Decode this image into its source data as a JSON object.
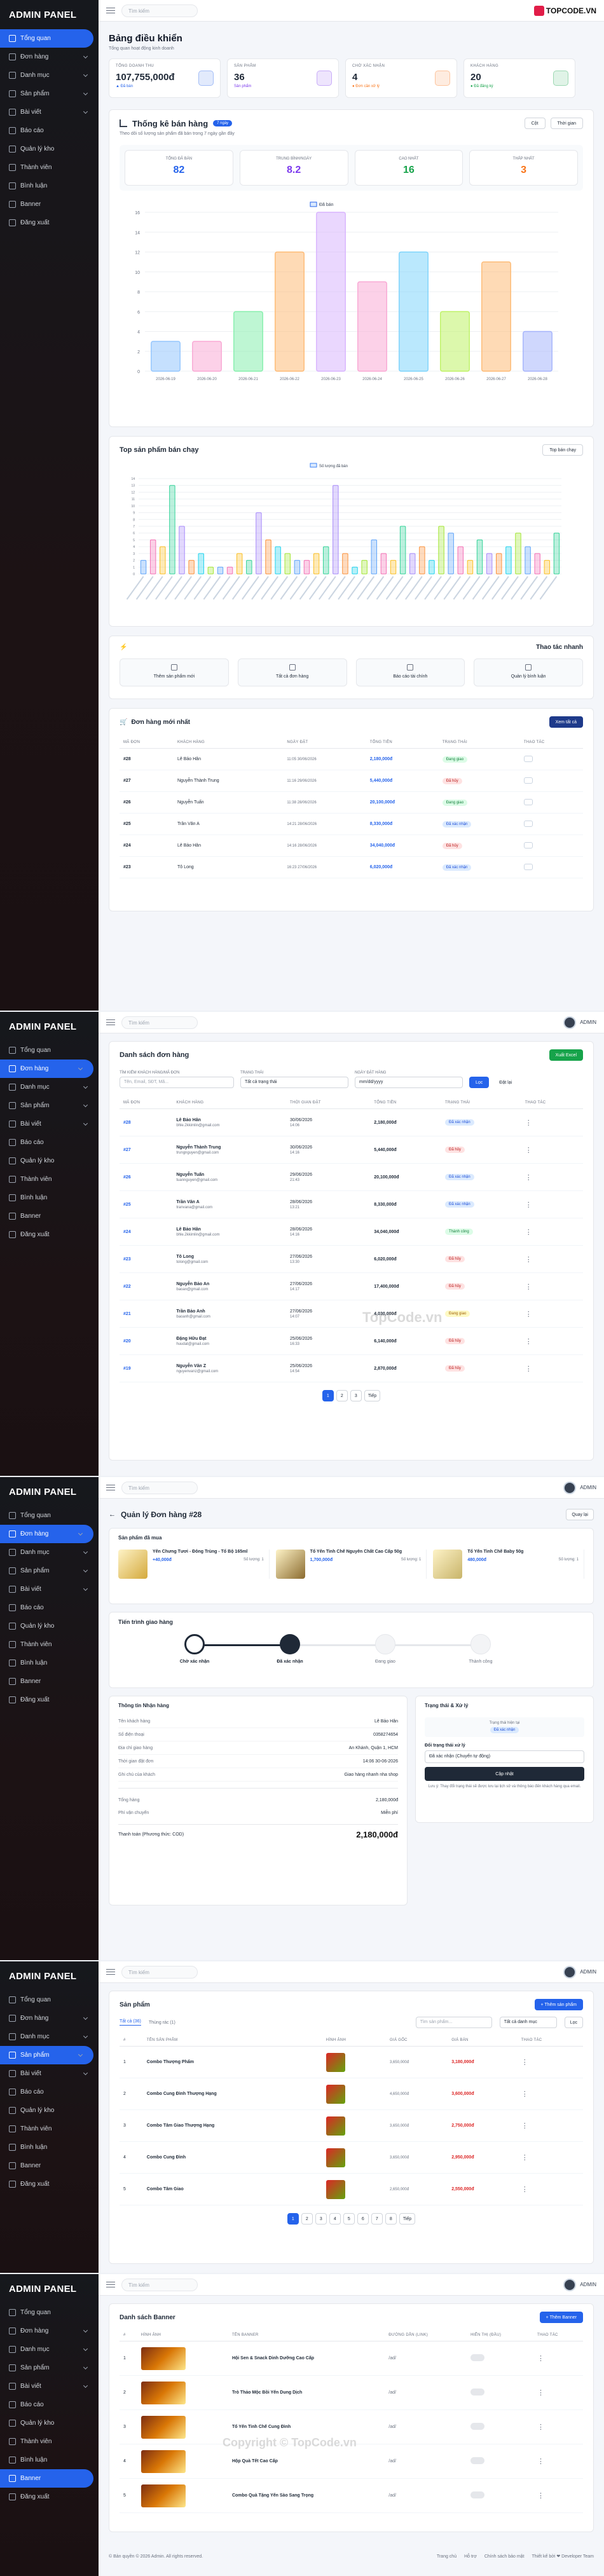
{
  "logo": {
    "brand": "TOPCODE.VN"
  },
  "watermarks": [
    "TopCode.vn",
    "Copyright © TopCode.vn"
  ],
  "sidebar": {
    "brand": "ADMIN PANEL",
    "items": [
      {
        "label": "Tổng quan",
        "icon": "grid-icon"
      },
      {
        "label": "Đơn hàng",
        "icon": "cart-icon"
      },
      {
        "label": "Danh mục",
        "icon": "folder-icon"
      },
      {
        "label": "Sản phẩm",
        "icon": "box-icon"
      },
      {
        "label": "Bài viết",
        "icon": "doc-icon"
      },
      {
        "label": "Báo cáo",
        "icon": "chart-icon"
      },
      {
        "label": "Quản lý kho",
        "icon": "warehouse-icon"
      },
      {
        "label": "Thành viên",
        "icon": "users-icon"
      },
      {
        "label": "Bình luận",
        "icon": "comment-icon"
      },
      {
        "label": "Banner",
        "icon": "image-icon"
      },
      {
        "label": "Đăng xuất",
        "icon": "logout-icon"
      }
    ]
  },
  "topbar": {
    "search_placeholder": "Tìm kiếm",
    "user": "ADMIN"
  },
  "dashboard": {
    "title": "Bảng điều khiển",
    "subtitle": "Tổng quan hoạt động kinh doanh",
    "stats": [
      {
        "label": "TỔNG DOANH THU",
        "value": "107,755,000đ",
        "sub": "▲ Đã bán",
        "color": "#2563eb"
      },
      {
        "label": "SẢN PHẨM",
        "value": "36",
        "sub": "Sản phẩm",
        "color": "#7c3aed"
      },
      {
        "label": "CHỜ XÁC NHẬN",
        "value": "4",
        "sub": "● Đơn cần xử lý",
        "color": "#f97316"
      },
      {
        "label": "KHÁCH HÀNG",
        "value": "20",
        "sub": "● Đã đăng ký",
        "color": "#16a34a"
      }
    ],
    "sales": {
      "title": "Thống kê bán hàng",
      "tag": "7 ngày",
      "desc": "Theo dõi số lượng sản phẩm đã bán trong 7 ngày gần đây",
      "btn_type": "Cột",
      "btn_time": "Thời gian",
      "kpis": [
        {
          "label": "TỔNG ĐÃ BÁN",
          "value": "82",
          "color": "#2563eb"
        },
        {
          "label": "TRUNG BÌNH/NGÀY",
          "value": "8.2",
          "color": "#7c3aed"
        },
        {
          "label": "CAO NHẤT",
          "value": "16",
          "color": "#16a34a"
        },
        {
          "label": "THẤP NHẤT",
          "value": "3",
          "color": "#f97316"
        }
      ]
    },
    "top_products": {
      "title": "Top sản phẩm bán chạy",
      "select": "Top bán chạy"
    },
    "quick": {
      "title": "Thao tác nhanh",
      "items": [
        "Thêm sản phẩm mới",
        "Tất cả đơn hàng",
        "Báo cáo tài chính",
        "Quản lý bình luận"
      ]
    },
    "recent": {
      "title": "Đơn hàng mới nhất",
      "btn": "Xem tất cả",
      "headers": [
        "MÃ ĐƠN",
        "KHÁCH HÀNG",
        "NGÀY ĐẶT",
        "TỔNG TIỀN",
        "TRẠNG THÁI",
        "THAO TÁC"
      ],
      "rows": [
        {
          "id": "#28",
          "name": "Lê Bảo Hân",
          "date": "11:05 30/06/2026",
          "total": "2,180,000đ",
          "status": "Đang giao",
          "c": "g"
        },
        {
          "id": "#27",
          "name": "Nguyễn Thành Trung",
          "date": "11:16 29/06/2026",
          "total": "5,440,000đ",
          "status": "Đã hủy",
          "c": "r"
        },
        {
          "id": "#26",
          "name": "Nguyễn Tuấn",
          "date": "11:38 28/06/2026",
          "total": "20,100,000đ",
          "status": "Đang giao",
          "c": "g"
        },
        {
          "id": "#25",
          "name": "Trần Văn A",
          "date": "14:21 28/06/2026",
          "total": "8,330,000đ",
          "status": "Đã xác nhận",
          "c": "b"
        },
        {
          "id": "#24",
          "name": "Lê Bảo Hân",
          "date": "14:16 28/06/2026",
          "total": "34,040,000đ",
          "status": "Đã hủy",
          "c": "r"
        },
        {
          "id": "#23",
          "name": "Tô Long",
          "date": "16:23 27/06/2026",
          "total": "6,020,000đ",
          "status": "Đã xác nhận",
          "c": "b"
        }
      ]
    }
  },
  "chart_data": [
    {
      "type": "bar",
      "series": [
        {
          "name": "Đã bán",
          "values": [
            3,
            3,
            6,
            12,
            16,
            9,
            12,
            6,
            11,
            4
          ]
        }
      ],
      "categories": [
        "2026-06-19",
        "2026-06-20",
        "2026-06-21",
        "2026-06-22",
        "2026-06-23",
        "2026-06-24",
        "2026-06-25",
        "2026-06-26",
        "2026-06-27",
        "2026-06-28"
      ],
      "yticks": [
        "0",
        "2",
        "4",
        "6",
        "8",
        "10",
        "12",
        "14",
        "16"
      ],
      "ylim": [
        0,
        16
      ]
    },
    {
      "type": "bar",
      "series": [
        {
          "name": "Số lượng đã bán",
          "values": [
            2,
            5,
            4,
            13,
            7,
            2,
            3,
            1,
            1,
            1,
            3,
            2,
            9,
            5,
            4,
            3,
            2,
            2,
            3,
            4,
            13,
            3,
            1,
            2,
            5,
            3,
            2,
            7,
            3,
            4,
            2,
            7,
            6,
            4,
            2,
            5,
            3,
            3,
            4,
            6,
            4,
            3,
            2,
            6
          ]
        }
      ],
      "yticks": [
        "0",
        "1",
        "2",
        "3",
        "4",
        "5",
        "6",
        "7",
        "8",
        "9",
        "10",
        "11",
        "12",
        "13",
        "14"
      ],
      "ylim": [
        0,
        14
      ]
    }
  ],
  "orders": {
    "title": "Danh sách đơn hàng",
    "export": "Xuất Excel",
    "f_search_label": "TÌM KIẾM KHÁCH HÀNG/MÃ ĐƠN",
    "f_search_ph": "Tên, Email, SĐT, Mã...",
    "f_status_label": "TRẠNG THÁI",
    "f_status": "Tất cả trạng thái",
    "f_date_label": "NGÀY ĐẶT HÀNG",
    "f_date": "mm/dd/yyyy",
    "btn_filter": "Lọc",
    "btn_reset": "Đặt lại",
    "headers": [
      "MÃ ĐƠN",
      "KHÁCH HÀNG",
      "THỜI GIAN ĐẶT",
      "TỔNG TIỀN",
      "TRẠNG THÁI",
      "THAO TÁC"
    ],
    "rows": [
      {
        "id": "#28",
        "name": "Lê Bảo Hân",
        "email": "bhle.2kkimlin@gmail.com",
        "date": "30/06/2026",
        "time": "14:06",
        "total": "2,180,000đ",
        "status": "Đã xác nhận",
        "c": "b"
      },
      {
        "id": "#27",
        "name": "Nguyễn Thành Trung",
        "email": "trungnguyen@gmail.com",
        "date": "30/06/2026",
        "time": "14:16",
        "total": "5,440,000đ",
        "status": "Đã hủy",
        "c": "r"
      },
      {
        "id": "#26",
        "name": "Nguyễn Tuấn",
        "email": "tuannguyen@gmail.com",
        "date": "29/06/2026",
        "time": "21:43",
        "total": "20,100,000đ",
        "status": "Đã xác nhận",
        "c": "b"
      },
      {
        "id": "#25",
        "name": "Trần Văn A",
        "email": "tranvana@gmail.com",
        "date": "28/06/2026",
        "time": "13:21",
        "total": "8,330,000đ",
        "status": "Đã xác nhận",
        "c": "b"
      },
      {
        "id": "#24",
        "name": "Lê Bảo Hân",
        "email": "bhle.2kkimlin@gmail.com",
        "date": "28/06/2026",
        "time": "14:16",
        "total": "34,040,000đ",
        "status": "Thành công",
        "c": "g"
      },
      {
        "id": "#23",
        "name": "Tô Long",
        "email": "tolong@gmail.com",
        "date": "27/06/2026",
        "time": "13:30",
        "total": "6,020,000đ",
        "status": "Đã hủy",
        "c": "r"
      },
      {
        "id": "#22",
        "name": "Nguyễn Bảo An",
        "email": "baoan@gmail.com",
        "date": "27/06/2026",
        "time": "14:17",
        "total": "17,400,000đ",
        "status": "Đã hủy",
        "c": "r"
      },
      {
        "id": "#21",
        "name": "Trần Bảo Anh",
        "email": "baoanh@gmail.com",
        "date": "27/06/2026",
        "time": "14:07",
        "total": "4,030,000đ",
        "status": "Đang giao",
        "c": "y"
      },
      {
        "id": "#20",
        "name": "Đặng Hữu Đạt",
        "email": "huudat@gmail.com",
        "date": "25/06/2026",
        "time": "16:33",
        "total": "6,140,000đ",
        "status": "Đã hủy",
        "c": "r"
      },
      {
        "id": "#19",
        "name": "Nguyễn Văn Z",
        "email": "nguyenvanz@gmail.com",
        "date": "25/06/2026",
        "time": "14:54",
        "total": "2,870,000đ",
        "status": "Đã hủy",
        "c": "r"
      }
    ],
    "pages": [
      "1",
      "2",
      "3",
      "Tiếp"
    ]
  },
  "order_detail": {
    "title": "Quản lý Đơn hàng #28",
    "back": "Quay lại",
    "items_title": "Sản phẩm đã mua",
    "items": [
      {
        "name": "Yến Chưng Tươi - Đông Trùng - Tổ Bộ 165ml",
        "price": "+40,000đ",
        "qty": "Số lượng: 1"
      },
      {
        "name": "Tổ Yến Tinh Chế Nguyên Chất Cao Cấp 50g",
        "price": "1,700,000đ",
        "qty": "Số lượng: 1"
      },
      {
        "name": "Tổ Yến Tinh Chế Baby 50g",
        "price": "480,000đ",
        "qty": "Số lượng: 1"
      }
    ],
    "progress_title": "Tiến trình giao hàng",
    "steps": [
      "Chờ xác nhận",
      "Đã xác nhận",
      "Đang giao",
      "Thành công"
    ],
    "recv_title": "Thông tin Nhận hàng",
    "recv": [
      {
        "k": "Tên khách hàng",
        "v": "Lê Bảo Hân"
      },
      {
        "k": "Số điện thoại",
        "v": "0358274654"
      },
      {
        "k": "Địa chỉ giao hàng",
        "v": "An Khánh, Quận 1, HCM"
      },
      {
        "k": "Thời gian đặt đơn",
        "v": "14:06 30-06-2026"
      },
      {
        "k": "Ghi chú của khách",
        "v": "Giao hàng nhanh nha shop"
      }
    ],
    "sum": [
      {
        "k": "Tổng hàng",
        "v": "2,180,000đ"
      },
      {
        "k": "Phí vận chuyển",
        "v": "Miễn phí"
      }
    ],
    "pay_label": "Thanh toán (Phương thức: COD)",
    "pay_total": "2,180,000đ",
    "status_title": "Trạng thái & Xử lý",
    "status_now_label": "Trạng thái hiện tại",
    "status_now": "Đã xác nhận",
    "update_label": "Đổi trạng thái xử lý",
    "update_select": "Đã xác nhận (Chuyển tự động)",
    "update_btn": "Cập nhật",
    "note": "Lưu ý: Thay đổi trạng thái sẽ được lưu lại lịch sử và thông báo đến khách hàng qua email."
  },
  "products": {
    "title": "Sản phẩm",
    "add": "+ Thêm sản phẩm",
    "tabs": [
      "Tất cả (36)",
      "Thùng rác (1)"
    ],
    "search_ph": "Tìm sản phẩm...",
    "cat": "Tất cả danh mục",
    "btn": "Lọc",
    "headers": [
      "#",
      "TÊN SẢN PHẨM",
      "HÌNH ẢNH",
      "GIÁ GỐC",
      "GIÁ BÁN",
      "THAO TÁC"
    ],
    "rows": [
      {
        "n": "1",
        "name": "Combo Thượng Phẩm",
        "old": "3,650,000đ",
        "price": "3,180,000đ"
      },
      {
        "n": "2",
        "name": "Combo Cung Đình Thượng Hạng",
        "old": "4,650,000đ",
        "price": "3,600,000đ"
      },
      {
        "n": "3",
        "name": "Combo Tâm Giao Thượng Hạng",
        "old": "3,650,000đ",
        "price": "2,750,000đ"
      },
      {
        "n": "4",
        "name": "Combo Cung Đình",
        "old": "3,650,000đ",
        "price": "2,950,000đ"
      },
      {
        "n": "5",
        "name": "Combo Tâm Giao",
        "old": "2,650,000đ",
        "price": "2,550,000đ"
      }
    ],
    "pages": [
      "1",
      "2",
      "3",
      "4",
      "5",
      "6",
      "7",
      "8",
      "Tiếp"
    ]
  },
  "banners": {
    "title": "Danh sách Banner",
    "add": "+ Thêm Banner",
    "headers": [
      "#",
      "HÌNH ẢNH",
      "TÊN BANNER",
      "ĐƯỜNG DẪN (LINK)",
      "HIỂN THỊ (ĐẦU)",
      "THAO TÁC"
    ],
    "rows": [
      {
        "n": "1",
        "name": "Hội Sen & Snack Dinh Dưỡng Cao Cấp",
        "link": "/ad/"
      },
      {
        "n": "2",
        "name": "Trò Thảo Mộc Bồi Yến Dung Dịch",
        "link": "/ad/"
      },
      {
        "n": "3",
        "name": "Tổ Yến Tinh Chế Cung Đình",
        "link": "/ad/"
      },
      {
        "n": "4",
        "name": "Hộp Quà Tết Cao Cấp",
        "link": "/ad/"
      },
      {
        "n": "5",
        "name": "Combo Quà Tặng Yến Sào Sang Trọng",
        "link": "/ad/"
      }
    ]
  },
  "footer": {
    "copy": "© Bản quyền © 2026 Admin. All rights reserved.",
    "links": [
      "Trang chủ",
      "Hỗ trợ",
      "Chính sách bảo mật"
    ],
    "credit": "Thiết kế bởi ❤ Developer Team"
  }
}
